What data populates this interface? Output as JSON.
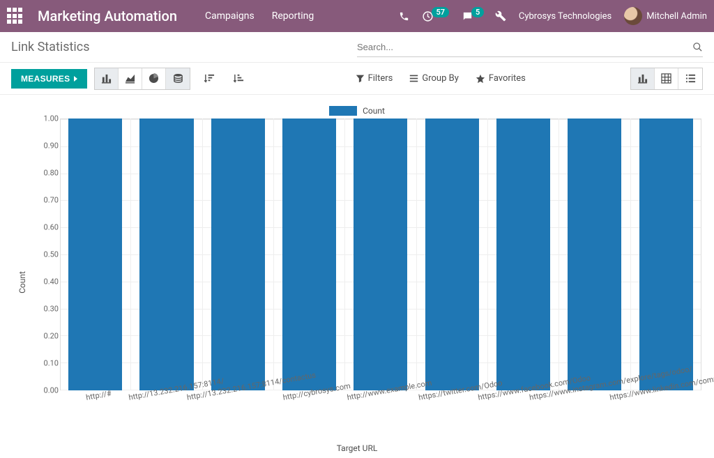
{
  "header": {
    "brand": "Marketing Automation",
    "nav": {
      "campaigns": "Campaigns",
      "reporting": "Reporting"
    },
    "company": "Cybrosys Technologies",
    "user": "Mitchell Admin",
    "badges": {
      "activities": "57",
      "discuss": "5"
    }
  },
  "breadcrumb": {
    "title": "Link Statistics"
  },
  "search": {
    "placeholder": "Search..."
  },
  "toolbar": {
    "measures_label": "MEASURES",
    "filters": "Filters",
    "group_by": "Group By",
    "favorites": "Favorites"
  },
  "chart_data": {
    "type": "bar",
    "title": "",
    "legend": "Count",
    "xlabel": "Target URL",
    "ylabel": "Count",
    "ylim": [
      0,
      1.0
    ],
    "ytick_step": 0.1,
    "categories": [
      "http://#",
      "http://13.232.216.157:8114/",
      "http://13.232.216.157:8114/contactus",
      "http://cybrosys.com",
      "http://www.example.com",
      "https://twitter.com/Odoo",
      "https://www.facebook.com/Odoo",
      "https://www.instagram.com/explore/tags/odoo/",
      "https://www.linkedin.com/company/odoo"
    ],
    "values": [
      1.0,
      1.0,
      1.0,
      1.0,
      1.0,
      1.0,
      1.0,
      1.0,
      1.0
    ]
  },
  "colors": {
    "bar": "#1f77b4",
    "accent": "#00a09d",
    "nav": "#875a7b"
  }
}
